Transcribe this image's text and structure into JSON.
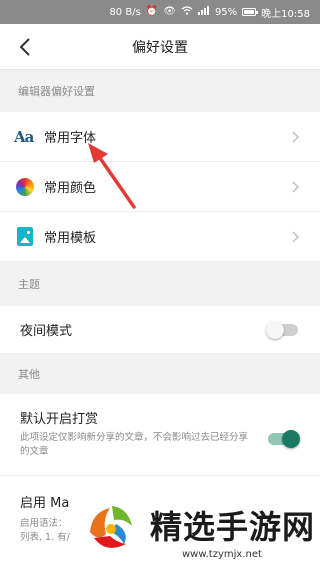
{
  "status_bar": {
    "speed": "80 B/s",
    "battery": "95%",
    "battery_level": 0.95,
    "time": "晚上10:58",
    "icons": [
      "alarm-icon",
      "eye-icon",
      "wifi-icon",
      "signal-icon",
      "battery-icon"
    ]
  },
  "nav": {
    "title": "偏好设置",
    "back_icon": "back-chevron-icon"
  },
  "sections": {
    "editor": {
      "header": "编辑器偏好设置",
      "items": [
        {
          "label": "常用字体",
          "icon": "font-aa-icon",
          "icon_text": "Aa"
        },
        {
          "label": "常用颜色",
          "icon": "color-wheel-icon"
        },
        {
          "label": "常用模板",
          "icon": "template-icon"
        }
      ]
    },
    "theme": {
      "header": "主题",
      "night_mode": {
        "label": "夜间模式",
        "enabled": false
      }
    },
    "other": {
      "header": "其他",
      "reward": {
        "label": "默认开启打赏",
        "description": "此项设定仅影响新分享的文章，不会影响过去已经分享的文章",
        "enabled": true
      },
      "markdown": {
        "label": "启用 Ma",
        "description_line1": "启用语法：",
        "description_line2": "列表, 1. 有/"
      }
    }
  },
  "watermark": {
    "text": "精选手游网",
    "url": "www.tzymjx.net"
  },
  "colors": {
    "accent_green": "#1a7a63",
    "annotation_red": "#e53935",
    "font_icon_blue": "#1f5a85"
  }
}
